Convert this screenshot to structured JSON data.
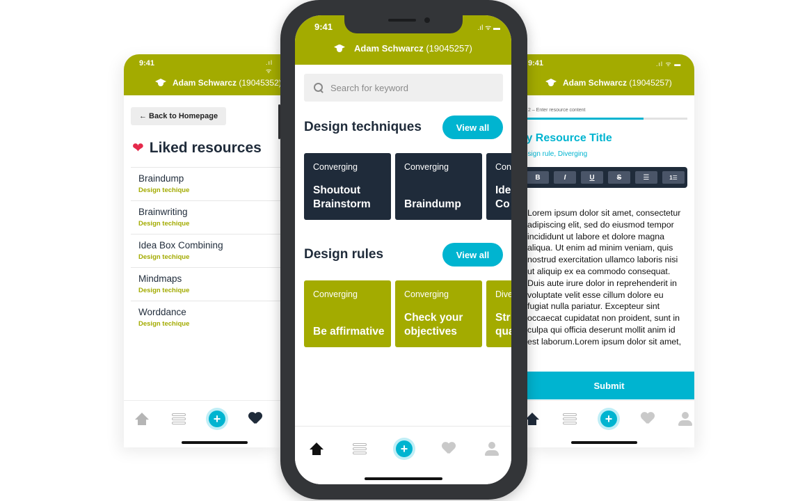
{
  "left_screen": {
    "time": "9:41",
    "status_icons": ".ıl ᯤ",
    "user_name": "Adam Schwarcz",
    "user_id": "(19045352)",
    "back_label": "← Back to Homepage",
    "title": "Liked resources",
    "items": [
      {
        "title": "Braindump",
        "category": "Design techique"
      },
      {
        "title": "Brainwriting",
        "category": "Design techique"
      },
      {
        "title": "Idea Box Combining",
        "category": "Design techique"
      },
      {
        "title": "Mindmaps",
        "category": "Design techique"
      },
      {
        "title": "Worddance",
        "category": "Design techique"
      }
    ]
  },
  "center_screen": {
    "time": "9:41",
    "status_icons": ".ıl ᯤ ▬",
    "user_name": "Adam Schwarcz",
    "user_id": "(19045257)",
    "search_placeholder": "Search for keyword",
    "sections": [
      {
        "title": "Design techniques",
        "view_all": "View all",
        "cards": [
          {
            "category": "Converging",
            "name": "Shoutout Brainstorm"
          },
          {
            "category": "Converging",
            "name": "Braindump"
          },
          {
            "category": "Con",
            "name": "Ide Co"
          }
        ]
      },
      {
        "title": "Design rules",
        "view_all": "View all",
        "cards": [
          {
            "category": "Converging",
            "name": "Be affirmative"
          },
          {
            "category": "Converging",
            "name": "Check your objectives"
          },
          {
            "category": "Dive",
            "name": "Str qua"
          }
        ]
      }
    ],
    "nav": [
      "home-icon",
      "library-icon",
      "add-icon",
      "heart-icon",
      "profile-icon"
    ],
    "plus_glyph": "+"
  },
  "right_screen": {
    "time": "9:41",
    "status_icons": ".ıl ᯤ ▬",
    "user_name": "Adam Schwarcz",
    "user_id": "(19045257)",
    "step_label": "2 – Enter resource content",
    "progress": 0.73,
    "resource_title": "ly Resource Title",
    "resource_tags": "esign rule, Diverging",
    "toolbar": [
      "B",
      "I",
      "U",
      "S",
      "☰",
      "1☰"
    ],
    "body": "Lorem ipsum dolor sit amet, consectetur adipiscing elit, sed do eiusmod tempor incididunt ut labore et dolore magna aliqua. Ut enim ad minim veniam, quis nostrud exercitation ullamco laboris nisi ut aliquip ex ea commodo consequat. Duis aute irure dolor in reprehenderit in voluptate velit esse cillum dolore eu fugiat nulla pariatur. Excepteur sint occaecat cupidatat non proident, sunt in culpa qui officia deserunt mollit anim id est laborum.Lorem ipsum dolor sit amet,",
    "submit_label": "Submit",
    "plus_glyph": "+"
  },
  "colors": {
    "olive": "#a3ab00",
    "navy": "#1f2b3a",
    "cyan": "#00b4d0",
    "heart_red": "#e5294b"
  }
}
